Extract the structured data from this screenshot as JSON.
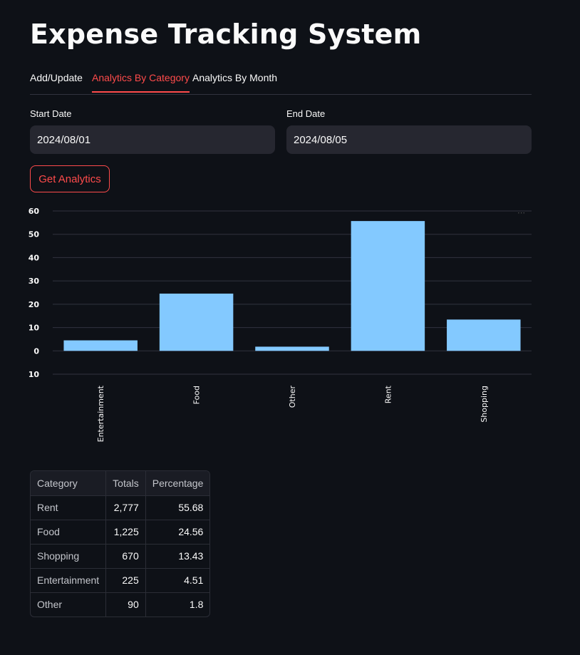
{
  "app": {
    "title": "Expense Tracking System"
  },
  "tabs": [
    {
      "label": "Add/Update",
      "active": false
    },
    {
      "label": "Analytics By Category",
      "active": true
    },
    {
      "label": "Analytics By Month",
      "active": false
    }
  ],
  "form": {
    "start_label": "Start Date",
    "start_value": "2024/08/01",
    "end_label": "End Date",
    "end_value": "2024/08/05",
    "button_label": "Get Analytics"
  },
  "colors": {
    "accent": "#ff4b4b",
    "bar": "#83c9ff",
    "background": "#0e1117"
  },
  "chart_data": {
    "type": "bar",
    "categories": [
      "Entertainment",
      "Food",
      "Other",
      "Rent",
      "Shopping"
    ],
    "values": [
      4.51,
      24.56,
      1.8,
      55.68,
      13.43
    ],
    "ylim": [
      -10,
      60
    ],
    "yticks": [
      60,
      50,
      40,
      30,
      20,
      10,
      0,
      -10
    ],
    "ytick_labels": [
      "60",
      "50",
      "40",
      "30",
      "20",
      "10",
      "0",
      "10"
    ],
    "grid": true,
    "xlabel": "",
    "ylabel": ""
  },
  "table": {
    "headers": [
      "Category",
      "Totals",
      "Percentage"
    ],
    "rows": [
      [
        "Rent",
        "2,777",
        "55.68"
      ],
      [
        "Food",
        "1,225",
        "24.56"
      ],
      [
        "Shopping",
        "670",
        "13.43"
      ],
      [
        "Entertainment",
        "225",
        "4.51"
      ],
      [
        "Other",
        "90",
        "1.8"
      ]
    ]
  }
}
